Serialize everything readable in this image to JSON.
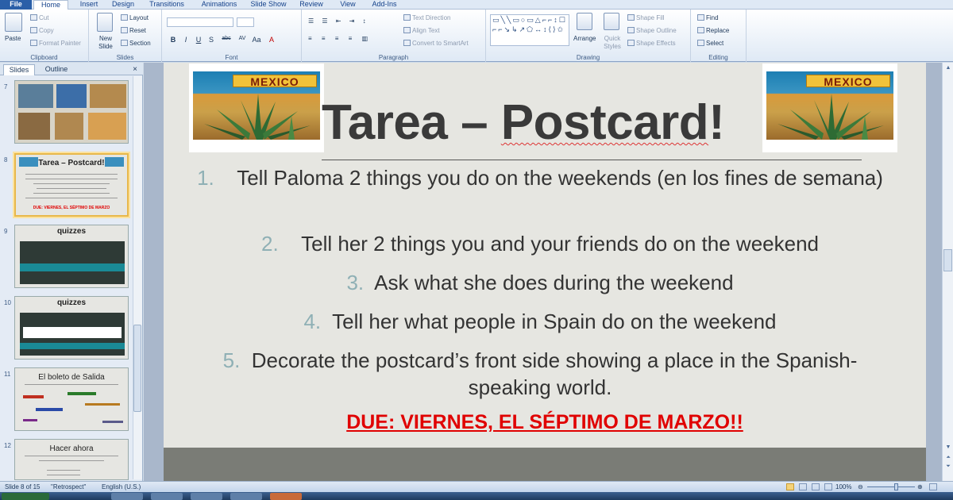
{
  "ribbon_tabs": [
    "File",
    "Home",
    "Insert",
    "Design",
    "Transitions",
    "Animations",
    "Slide Show",
    "Review",
    "View",
    "Add-Ins"
  ],
  "clipboard": {
    "paste": "Paste",
    "cut": "Cut",
    "copy": "Copy",
    "format_painter": "Format Painter",
    "label": "Clipboard"
  },
  "slides_group": {
    "new_slide": "New Slide",
    "layout": "Layout",
    "reset": "Reset",
    "section": "Section",
    "label": "Slides"
  },
  "font_group": {
    "label": "Font",
    "format_buttons": [
      "B",
      "I",
      "U",
      "S",
      "abc",
      "AV",
      "Aa",
      "A"
    ]
  },
  "paragraph_group": {
    "text_direction": "Text Direction",
    "align_text": "Align Text",
    "convert_smartart": "Convert to SmartArt",
    "label": "Paragraph"
  },
  "drawing_group": {
    "arrange": "Arrange",
    "quick_styles": "Quick Styles",
    "shape_fill": "Shape Fill",
    "shape_outline": "Shape Outline",
    "shape_effects": "Shape Effects",
    "label": "Drawing",
    "shapes_glyphs": "▭╲╲▭○▭△⌐⌐↕☐ ⌐⌐↘↳↗⬠↔↕⟨⟩✩"
  },
  "editing_group": {
    "find": "Find",
    "replace": "Replace",
    "select": "Select",
    "label": "Editing"
  },
  "pane_tabs": {
    "slides": "Slides",
    "outline": "Outline",
    "close": "×"
  },
  "thumbnails": [
    {
      "num": "7"
    },
    {
      "num": "8",
      "title": "Tarea – Postcard!",
      "due": "DUE: VIERNES, EL SÉPTIMO DE MARZO"
    },
    {
      "num": "9",
      "title": "quizzes"
    },
    {
      "num": "10",
      "title": "quizzes"
    },
    {
      "num": "11",
      "title": "El boleto de Salida"
    },
    {
      "num": "12",
      "title": "Hacer ahora"
    }
  ],
  "slide": {
    "postcard_banner": "MEXICO",
    "title_part1": "Tarea – ",
    "title_part2": "Postcard",
    "title_part3": "!",
    "items": [
      {
        "num": "1.",
        "text": "Tell Paloma 2 things you do on the weekends (en los fines de semana)"
      },
      {
        "num": "2.",
        "text": "Tell her 2 things you and your friends do on the weekend"
      },
      {
        "num": "3.",
        "text": "Ask what she does during the weekend"
      },
      {
        "num": "4.",
        "text": "Tell her what people in Spain do on the weekend"
      },
      {
        "num": "5.",
        "text": "Decorate the postcard’s front side showing a place in the Spanish-speaking world."
      }
    ],
    "due": "DUE: VIERNES, EL SÉPTIMO DE MARZO!!"
  },
  "status": {
    "slide_of": "Slide 8 of 15",
    "theme": "\"Retrospect\"",
    "language": "English (U.S.)",
    "zoom": "100%"
  },
  "colors": {
    "accent": "#2a5fa8",
    "due_red": "#e00000",
    "num_teal": "#8fb0b5"
  }
}
